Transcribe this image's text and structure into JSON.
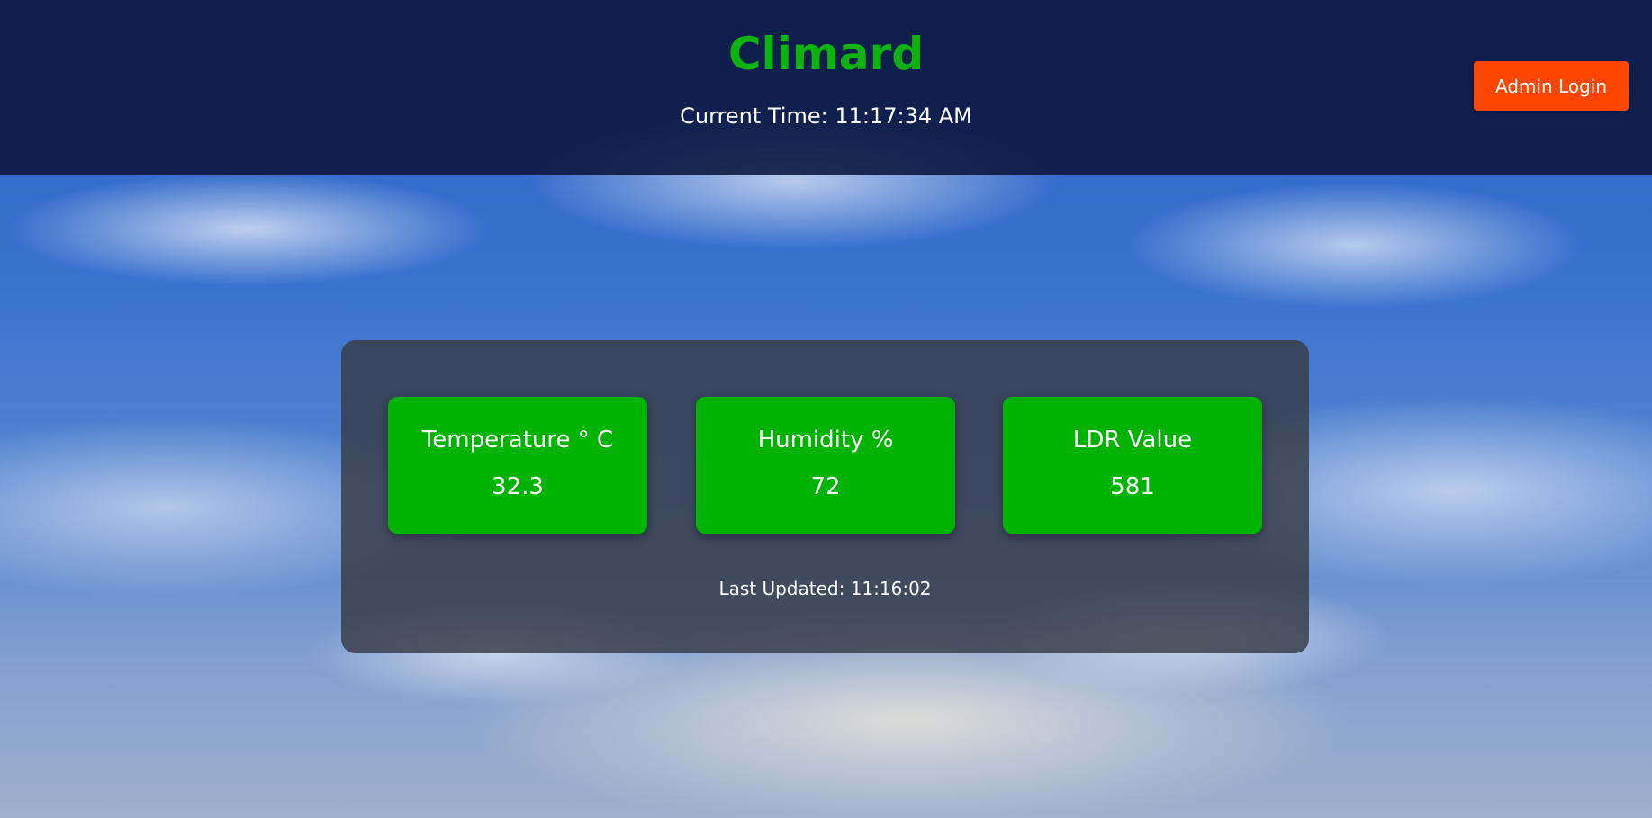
{
  "header": {
    "title": "Climard",
    "current_time": "Current Time: 11:17:34 AM",
    "admin_login_label": "Admin Login"
  },
  "readings": {
    "temperature": {
      "label": "Temperature ° C",
      "value": "32.3"
    },
    "humidity": {
      "label": "Humidity %",
      "value": "72"
    },
    "ldr": {
      "label": "LDR Value",
      "value": "581"
    }
  },
  "last_updated": "Last Updated: 11:16:02",
  "colors": {
    "title_green": "#0cb30c",
    "card_green": "#00b300",
    "admin_button": "#ff4500",
    "header_bg": "#0a163c"
  }
}
